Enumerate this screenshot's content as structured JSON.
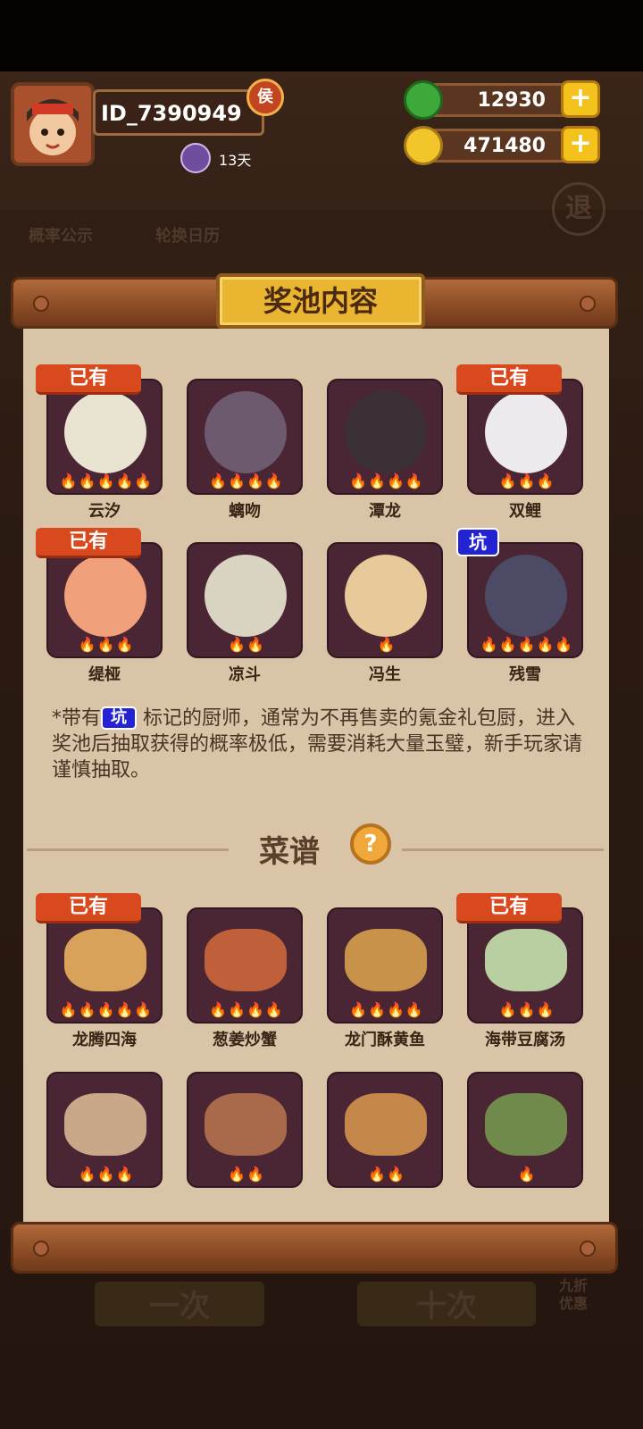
{
  "header": {
    "player_id": "ID_7390949",
    "vip_badge": "侯",
    "days_label": "13天",
    "jade_amount": "12930",
    "coin_amount": "471480",
    "add_symbol": "+"
  },
  "background_buttons": {
    "probability_label": "概率公示",
    "rotation_label": "轮换日历",
    "exit_label": "退"
  },
  "dialog": {
    "title": "奖池内容",
    "chefs": [
      {
        "name": "云汐",
        "flames": "🔥🔥🔥🔥🔥",
        "tag": "已有"
      },
      {
        "name": "螭吻",
        "flames": "🔥🔥🔥🔥",
        "tag": ""
      },
      {
        "name": "潭龙",
        "flames": "🔥🔥🔥🔥",
        "tag": ""
      },
      {
        "name": "双鲤",
        "flames": "🔥🔥🔥",
        "tag": "已有"
      },
      {
        "name": "缇桠",
        "flames": "🔥🔥🔥",
        "tag": "已有"
      },
      {
        "name": "凉斗",
        "flames": "🔥🔥",
        "tag": ""
      },
      {
        "name": "冯生",
        "flames": "🔥",
        "tag": ""
      },
      {
        "name": "残雪",
        "flames": "🔥🔥🔥🔥🔥",
        "tag": "坑"
      }
    ],
    "note_prefix": "*带有",
    "note_pit": "坑",
    "note_text": " 标记的厨师，通常为不再售卖的氪金礼包厨，进入奖池后抽取获得的概率极低，需要消耗大量玉璧，新手玩家请谨慎抽取。",
    "recipes_title": "菜谱",
    "help_symbol": "?",
    "recipes": [
      {
        "name": "龙腾四海",
        "flames": "🔥🔥🔥🔥🔥",
        "tag": "已有"
      },
      {
        "name": "葱姜炒蟹",
        "flames": "🔥🔥🔥🔥",
        "tag": ""
      },
      {
        "name": "龙门酥黄鱼",
        "flames": "🔥🔥🔥🔥",
        "tag": ""
      },
      {
        "name": "海带豆腐汤",
        "flames": "🔥🔥🔥",
        "tag": "已有"
      },
      {
        "name": "",
        "flames": "🔥🔥🔥",
        "tag": ""
      },
      {
        "name": "",
        "flames": "🔥🔥",
        "tag": ""
      },
      {
        "name": "",
        "flames": "🔥🔥",
        "tag": ""
      },
      {
        "name": "",
        "flames": "🔥",
        "tag": ""
      }
    ]
  },
  "bottom_buttons": {
    "single_label": "一次",
    "ten_label": "十次",
    "discount_label": "九折优惠"
  },
  "colors": {
    "owned_tag": "#d84a1e",
    "pit_tag": "#2323d4",
    "title_plate": "#eab531",
    "paper": "#d9c4a7",
    "card": "#4a2533"
  }
}
